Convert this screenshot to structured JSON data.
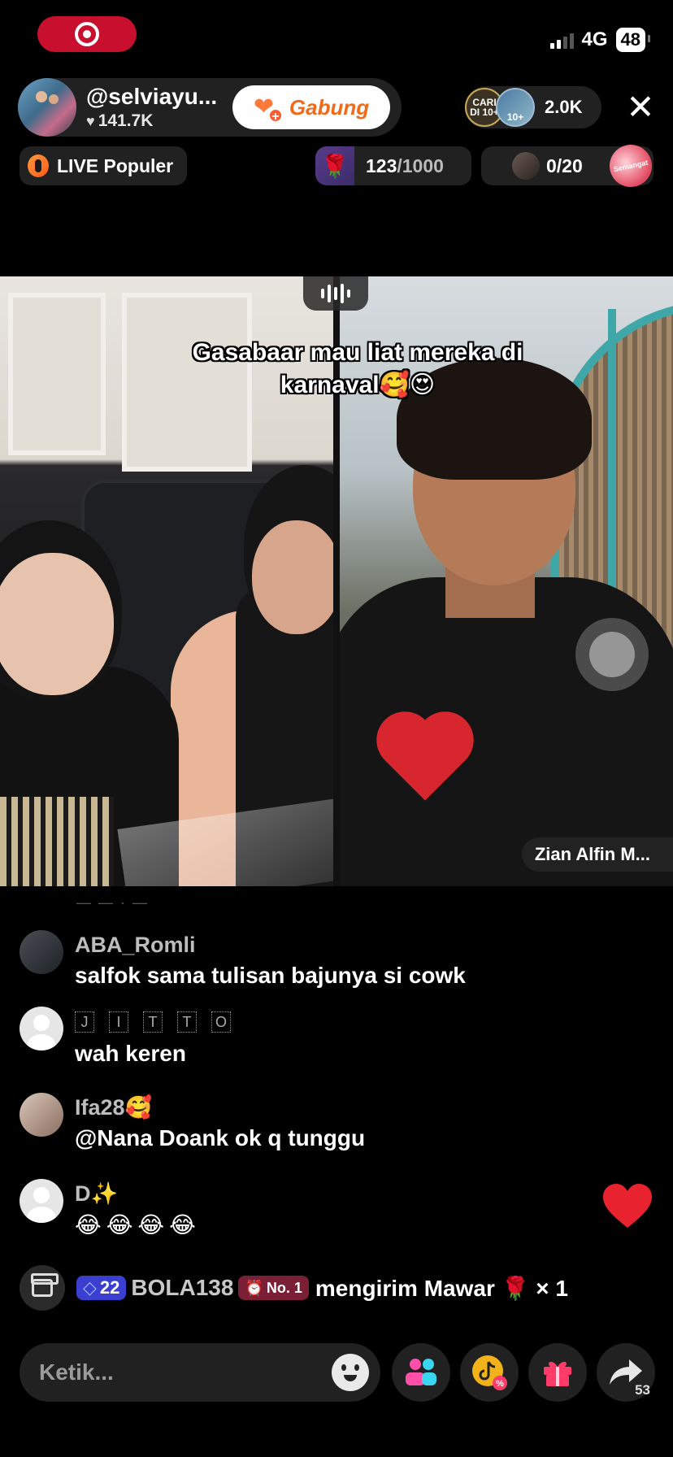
{
  "status": {
    "network": "4G",
    "battery": "48"
  },
  "host": {
    "name": "@selviayu...",
    "likes": "141.7K",
    "join_label": "Gabung"
  },
  "viewers": {
    "count": "2.0K",
    "avatar1_label": "CARI DI 10+",
    "avatar2_label": "10+"
  },
  "chips": {
    "popular": "LIVE Populer",
    "rose_progress": "123",
    "rose_goal": "/1000",
    "guest_count": "0/20",
    "sticker_text": "Semangat"
  },
  "video": {
    "caption": "Gasabaar mau liat mereka di karnaval🥰😍",
    "guest_name": "Zian Alfin M..."
  },
  "comments": [
    {
      "user": "ABA_Romli",
      "message": "salfok sama tulisan bajunya si cowk"
    },
    {
      "user": [
        "J",
        "I",
        "T",
        "T",
        "O"
      ],
      "message": "wah keren"
    },
    {
      "user": "Ifa28🥰",
      "message": "@Nana Doank ok q tunggu"
    },
    {
      "user": "D✨",
      "message": "😂😂😂😂"
    }
  ],
  "gift_event": {
    "level": "22",
    "user": "BOLA138",
    "rank": "No. 1",
    "message": "mengirim Mawar 🌹 × 1"
  },
  "bottom": {
    "input_placeholder": "Ketik...",
    "share_count": "53"
  },
  "colors": {
    "accent_join": "#f06a1a",
    "like_heart": "#e8232f",
    "status_pill": "#c8102e"
  }
}
